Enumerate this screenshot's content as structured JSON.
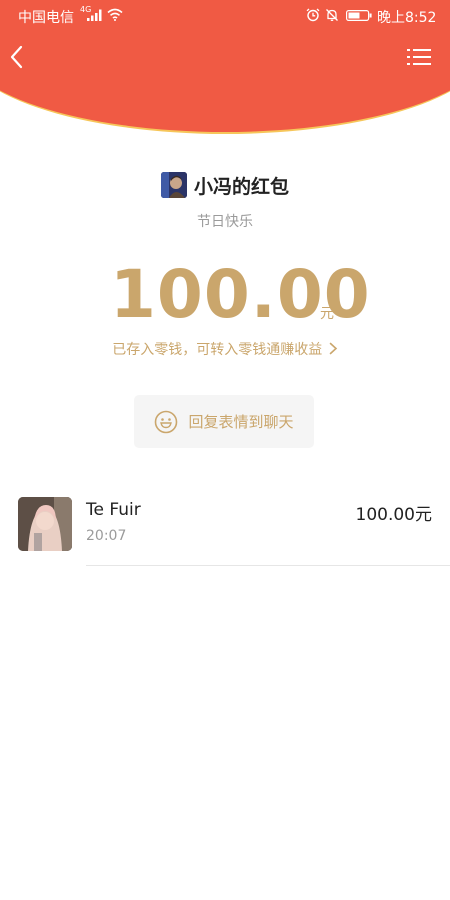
{
  "status_bar": {
    "carrier": "中国电信",
    "network_type": "4G",
    "time": "晚上8:52"
  },
  "header": {
    "back_icon": "chevron-left-icon",
    "menu_icon": "list-menu-icon",
    "background_color": "#f05a44",
    "accent_color": "#f6c65a"
  },
  "red_packet": {
    "title": "小冯的红包",
    "blessing": "节日快乐",
    "amount": "100.00",
    "unit": "元",
    "change_note": "已存入零钱，可转入零钱通赚收益",
    "amount_color": "#caa66c"
  },
  "reply": {
    "icon": "smiley-icon",
    "label": "回复表情到聊天"
  },
  "receivers": [
    {
      "name": "Te Fuir",
      "time": "20:07",
      "amount": "100.00元"
    }
  ]
}
